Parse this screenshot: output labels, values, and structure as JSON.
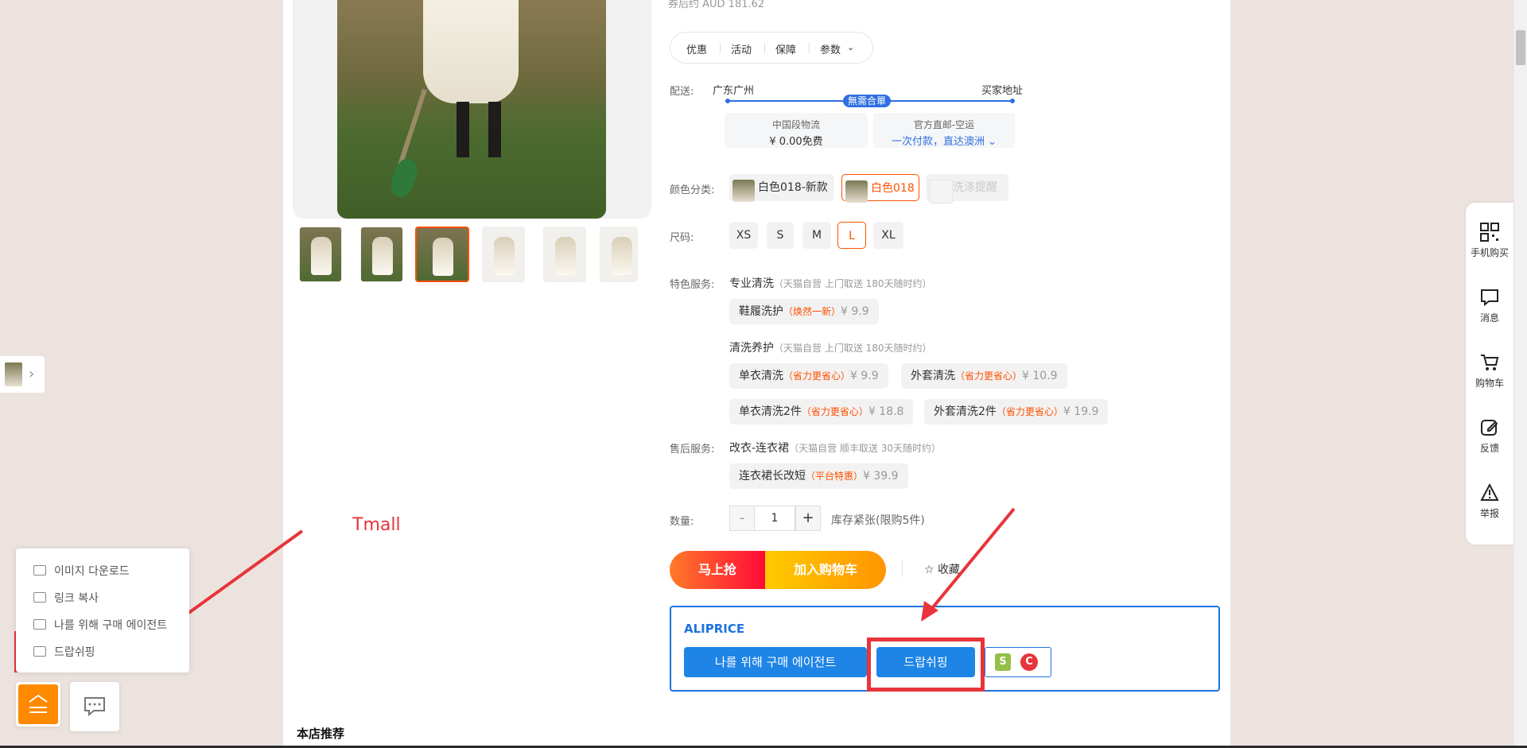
{
  "product": {
    "price_note": "券后约 AUD 181.62",
    "tabs": [
      "优惠",
      "活动",
      "保障",
      "参数"
    ],
    "delivery": {
      "label": "配送:",
      "from": "广东广州",
      "to": "买家地址",
      "badge": "無需合單",
      "option1_title": "中国段物流",
      "option1_value": "¥ 0.00免费",
      "option2_title": "官方直邮-空运",
      "option2_value": "一次付款，直达澳洲"
    },
    "color": {
      "label": "颜色分类:",
      "options": [
        "白色018-新款",
        "白色018",
        "洗涤提醒"
      ]
    },
    "size": {
      "label": "尺码:",
      "options": [
        "XS",
        "S",
        "M",
        "L",
        "XL"
      ]
    },
    "special_service": {
      "label": "特色服务:",
      "group1_title": "专业清洗",
      "group1_note": "（天猫自营 上门取送 180天随时约）",
      "group1_items": [
        {
          "name": "鞋履洗护",
          "tag": "（焕然一新）",
          "price": "¥ 9.9"
        }
      ],
      "group2_title": "清洗养护",
      "group2_note": "（天猫自营 上门取送 180天随时约）",
      "group2_items": [
        {
          "name": "单衣清洗",
          "tag": "（省力更省心）",
          "price": "¥ 9.9"
        },
        {
          "name": "外套清洗",
          "tag": "（省力更省心）",
          "price": "¥ 10.9"
        },
        {
          "name": "单衣清洗2件",
          "tag": "（省力更省心）",
          "price": "¥ 18.8"
        },
        {
          "name": "外套清洗2件",
          "tag": "（省力更省心）",
          "price": "¥ 19.9"
        }
      ]
    },
    "after_sale": {
      "label": "售后服务:",
      "title": "改衣-连衣裙",
      "note": "（天猫自营 顺丰取送 30天随时约）",
      "item": {
        "name": "连衣裙长改短",
        "tag": "（平台特惠）",
        "price": "¥ 39.9"
      }
    },
    "quantity": {
      "label": "数量:",
      "minus": "-",
      "value": "1",
      "plus": "+",
      "stock": "库存紧张(限购5件)"
    },
    "buy_now": "马上抢",
    "add_cart": "加入购物车",
    "favorite": "收藏"
  },
  "aliprice": {
    "title": "ALIPRICE",
    "agent_button": "나를 위해 구매 에이전트",
    "dropship_button": "드랍쉬핑"
  },
  "annotation": {
    "tmall_label": "Tmall",
    "colors": {
      "box": "#e8343a",
      "arrow": "#e8343a"
    }
  },
  "recommend_title": "本店推荐",
  "sidebar": [
    {
      "label": "手机购买",
      "icon": "qr-icon"
    },
    {
      "label": "消息",
      "icon": "message-icon"
    },
    {
      "label": "购物车",
      "icon": "cart-icon"
    },
    {
      "label": "反馈",
      "icon": "edit-icon"
    },
    {
      "label": "举报",
      "icon": "warning-icon"
    }
  ],
  "popup_menu": [
    "이미지 다운로드",
    "링크 복사",
    "나를 위해 구매 에이전트",
    "드랍쉬핑"
  ],
  "colors": {
    "accent": "#ff5000",
    "blue": "#1e84e6",
    "fab": "#ff8a00"
  }
}
